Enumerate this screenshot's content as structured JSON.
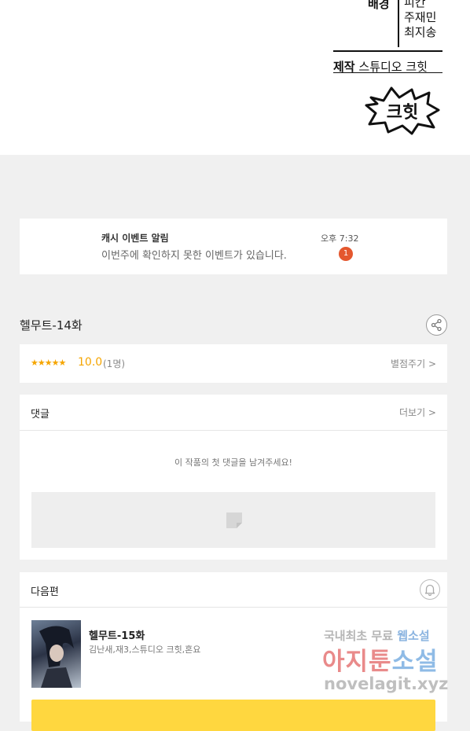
{
  "credits": {
    "role": "배경",
    "names": [
      "피칸",
      "주재민",
      "최지송"
    ],
    "production_label": "제작",
    "production_name": "스튜디오 크힛",
    "logo_text": "크힛"
  },
  "notification": {
    "title": "캐시 이벤트 알림",
    "message": "이번주에 확인하지 못한 이벤트가 있습니다.",
    "time": "오후 7:32",
    "badge": "1"
  },
  "episode": {
    "title": "헬무트-14화"
  },
  "rating": {
    "stars": "★★★★★",
    "score": "10.0",
    "count": "(1명)",
    "rate_link": "별점주기 >"
  },
  "comments": {
    "heading": "댓글",
    "more_link": "더보기 >",
    "empty_message": "이 작품의 첫 댓글을 남겨주세요!"
  },
  "next_episode": {
    "heading": "다음편",
    "title": "헬무트-15화",
    "authors": "김난새,재3,스튜디오 크힛,혼요"
  },
  "watermark": {
    "line1_a": "국내최초 무료 ",
    "line1_b": "웹소설",
    "line2_a": "아지툰",
    "line2_b": "소설",
    "line3": "novelagit.xyz"
  },
  "colors": {
    "accent_yellow": "#ffd73f",
    "star_orange": "#f5a500",
    "badge_red": "#e4572e"
  }
}
